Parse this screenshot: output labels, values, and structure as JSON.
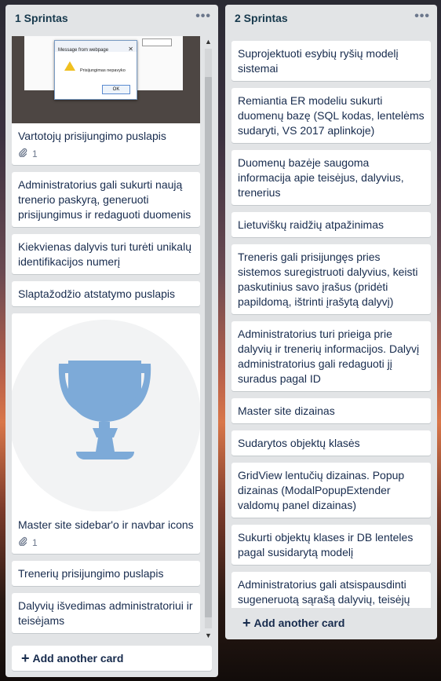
{
  "lists": [
    {
      "title": "1 Sprintas",
      "menu": "•••",
      "cards": [
        {
          "title": "Vartotojų prisijungimo puslapis",
          "attachments": "1",
          "cover": {
            "dialog_title": "Message from webpage",
            "dialog_message": "Prisijungimas nepavyko",
            "dialog_button": "OK"
          }
        },
        {
          "title": "Administratorius gali sukurti naują trenerio paskyrą, generuoti prisijungimus ir redaguoti duomenis"
        },
        {
          "title": "Kiekvienas dalyvis turi turėti unikalų identifikacijos numerį"
        },
        {
          "title": "Slaptažodžio atstatymo puslapis"
        },
        {
          "title": "Master site sidebar'o ir navbar icons",
          "attachments": "1"
        },
        {
          "title": "Trenerių prisijungimo puslapis"
        },
        {
          "title": "Dalyvių išvedimas administratoriui ir teisėjams"
        }
      ],
      "add_card": "Add another card"
    },
    {
      "title": "2 Sprintas",
      "menu": "•••",
      "cards": [
        {
          "title": "Suprojektuoti esybių ryšių modelį sistemai"
        },
        {
          "title": "Remiantia ER modeliu sukurti duomenų bazę (SQL kodas, lentelėms sudaryti, VS 2017 aplinkoje)"
        },
        {
          "title": "Duomenų bazėje saugoma informacija apie teisėjus, dalyvius, trenerius"
        },
        {
          "title": "Lietuviškų raidžių atpažinimas"
        },
        {
          "title": "Treneris gali prisijungęs pries sistemos suregistruoti dalyvius, keisti paskutinius savo įrašus (pridėti papildomą, ištrinti įrašytą dalyvį)"
        },
        {
          "title": "Administratorius turi prieiga prie dalyvių ir trenerių informacijos. Dalyvį administratorius gali redaguoti jį suradus pagal ID"
        },
        {
          "title": "Master site dizainas"
        },
        {
          "title": "Sudarytos objektų klasės"
        },
        {
          "title": "GridView lentučių dizainas. Popup dizainas (ModalPopupExtender valdomų panel dizainas)"
        },
        {
          "title": "Sukurti objektų klases ir DB lenteles pagal susidarytą modelį"
        },
        {
          "title": "Administratorius gali atsispausdinti sugeneruotą sąrašą dalyvių, teisėjų arba trenerių"
        }
      ],
      "add_card": "Add another card"
    }
  ],
  "icons": {
    "attachment": "paperclip-icon",
    "menu": "more-horizontal-icon",
    "add": "plus-icon",
    "trophy_color": "#7daad8"
  }
}
